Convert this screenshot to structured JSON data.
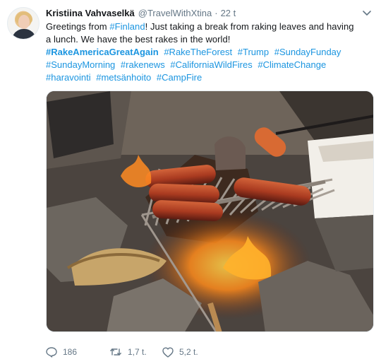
{
  "tweet": {
    "author_name": "Kristiina Vahvaselkä",
    "author_handle": "@TravelWithXtina",
    "separator": "·",
    "time": "22 t",
    "text_before_link": "Greetings from ",
    "text_link": "#Finland",
    "text_after_link": "! Just taking a break from raking leaves and having a lunch. We have the best rakes in the world!",
    "hashtags": [
      "#RakeAmericaGreatAgain",
      "#RakeTheForest",
      "#Trump",
      "#SundayFunday",
      "#SundayMorning",
      "#rakenews",
      "#CaliforniaWildFires",
      "#ClimateChange",
      "#haravointi",
      "#metsänhoito",
      "#CampFire"
    ],
    "replies": "186",
    "retweets": "1,7 t.",
    "likes": "5,2 t."
  },
  "colors": {
    "link": "#1b95e0",
    "secondary_text": "#657786",
    "primary_text": "#14171a"
  },
  "icons": {
    "reply": "reply-icon",
    "retweet": "retweet-icon",
    "like": "heart-icon",
    "menu": "chevron-down-icon"
  }
}
